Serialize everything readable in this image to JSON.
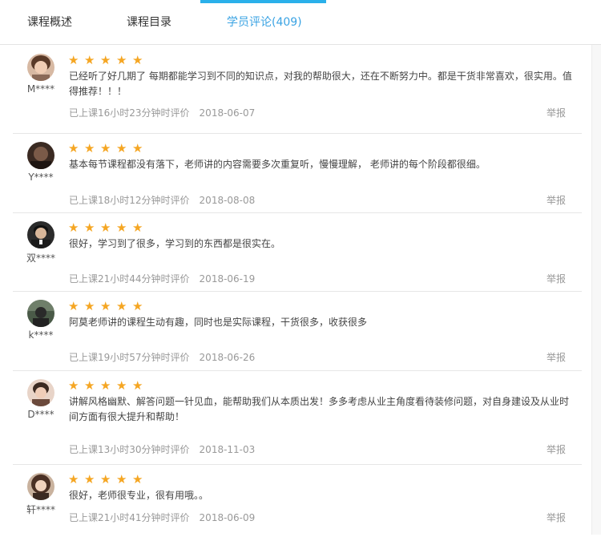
{
  "tabs": [
    {
      "label": "课程概述"
    },
    {
      "label": "课程目录"
    },
    {
      "label": "学员评论(409)"
    }
  ],
  "star_color": "#f5a623",
  "accent_color": "#2ab0ea",
  "reviews": [
    {
      "username": "M****",
      "rating": 5,
      "comment": "已经听了好几期了 每期都能学习到不同的知识点，对我的帮助很大，还在不断努力中。都是干货非常喜欢，很实用。值得推荐！！！",
      "meta": "已上课16小时23分钟时评价",
      "date": "2018-06-07",
      "report": "举报"
    },
    {
      "username": "Y****",
      "rating": 5,
      "comment": "基本每节课程都没有落下，老师讲的内容需要多次重复听，慢慢理解， 老师讲的每个阶段都很细。",
      "meta": "已上课18小时12分钟时评价",
      "date": "2018-08-08",
      "report": "举报"
    },
    {
      "username": "双****",
      "rating": 5,
      "comment": "很好，学习到了很多，学习到的东西都是很实在。",
      "meta": "已上课21小时44分钟时评价",
      "date": "2018-06-19",
      "report": "举报"
    },
    {
      "username": "k****",
      "rating": 5,
      "comment": "阿莫老师讲的课程生动有趣，同时也是实际课程，干货很多，收获很多",
      "meta": "已上课19小时57分钟时评价",
      "date": "2018-06-26",
      "report": "举报"
    },
    {
      "username": "D****",
      "rating": 5,
      "comment": "讲解风格幽默、解答问题一针见血，能帮助我们从本质出发！多多考虑从业主角度看待装修问题，对自身建设及从业时间方面有很大提升和帮助！",
      "meta": "已上课13小时30分钟时评价",
      "date": "2018-11-03",
      "report": "举报"
    },
    {
      "username": "轩****",
      "rating": 5,
      "comment": "很好，老师很专业，很有用哦。。",
      "meta": "已上课21小时41分钟时评价",
      "date": "2018-06-09",
      "report": "举报"
    }
  ]
}
